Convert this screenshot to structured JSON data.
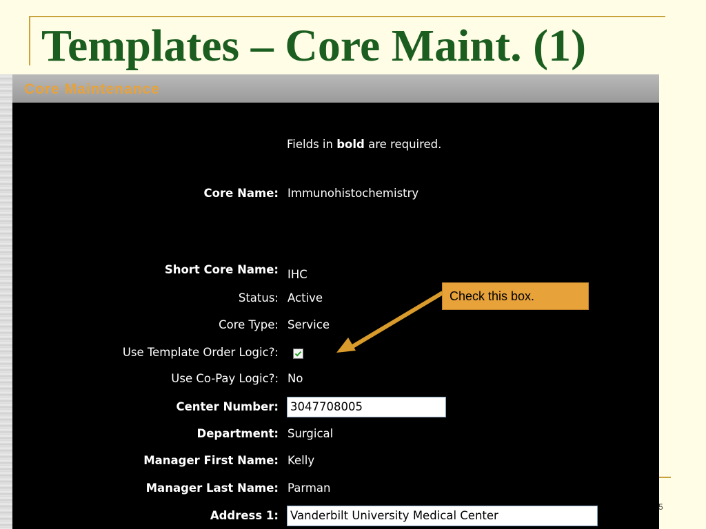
{
  "slide": {
    "title": "Templates – Core Maint. (1)",
    "number": "5"
  },
  "app": {
    "header_title": "Core Maintenance",
    "required_note": {
      "prefix": "Fields in ",
      "bold": "bold",
      "suffix": " are required."
    },
    "fields": {
      "core_name": {
        "label": "Core Name:",
        "value": "Immunohistochemistry"
      },
      "short_core_name": {
        "label": "Short Core Name:",
        "value": "IHC"
      },
      "status": {
        "label": "Status:",
        "value": "Active"
      },
      "core_type": {
        "label": "Core Type:",
        "value": "Service"
      },
      "template_order_logic": {
        "label": "Use Template Order Logic?:",
        "checked": true
      },
      "co_pay_logic": {
        "label": "Use Co-Pay Logic?:",
        "value": "No"
      },
      "center_number": {
        "label": "Center Number:",
        "value": "3047708005"
      },
      "department": {
        "label": "Department:",
        "value": "Surgical"
      },
      "manager_first_name": {
        "label": "Manager First Name:",
        "value": "Kelly"
      },
      "manager_last_name": {
        "label": "Manager Last Name:",
        "value": "Parman"
      },
      "address_1": {
        "label": "Address 1:",
        "value": "Vanderbilt University Medical Center"
      }
    }
  },
  "callout": {
    "text": "Check this box."
  },
  "colors": {
    "title_green": "#1b5e20",
    "accent_orange": "#e8a23a",
    "frame_gold": "#c8a33c",
    "slide_background": "#fffde6"
  }
}
